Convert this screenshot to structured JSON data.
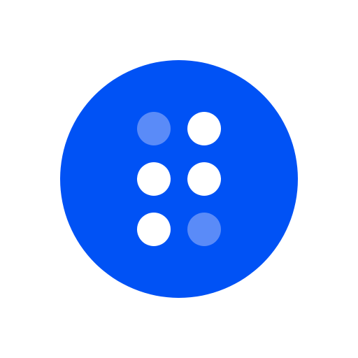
{
  "icon": {
    "name": "braille-dots-icon",
    "background_color": "#0052F5",
    "dot_color_filled": "#FFFFFF",
    "dot_color_muted": "#5A8BF8",
    "dots": [
      {
        "state": "muted"
      },
      {
        "state": "filled"
      },
      {
        "state": "filled"
      },
      {
        "state": "filled"
      },
      {
        "state": "filled"
      },
      {
        "state": "muted"
      }
    ]
  }
}
